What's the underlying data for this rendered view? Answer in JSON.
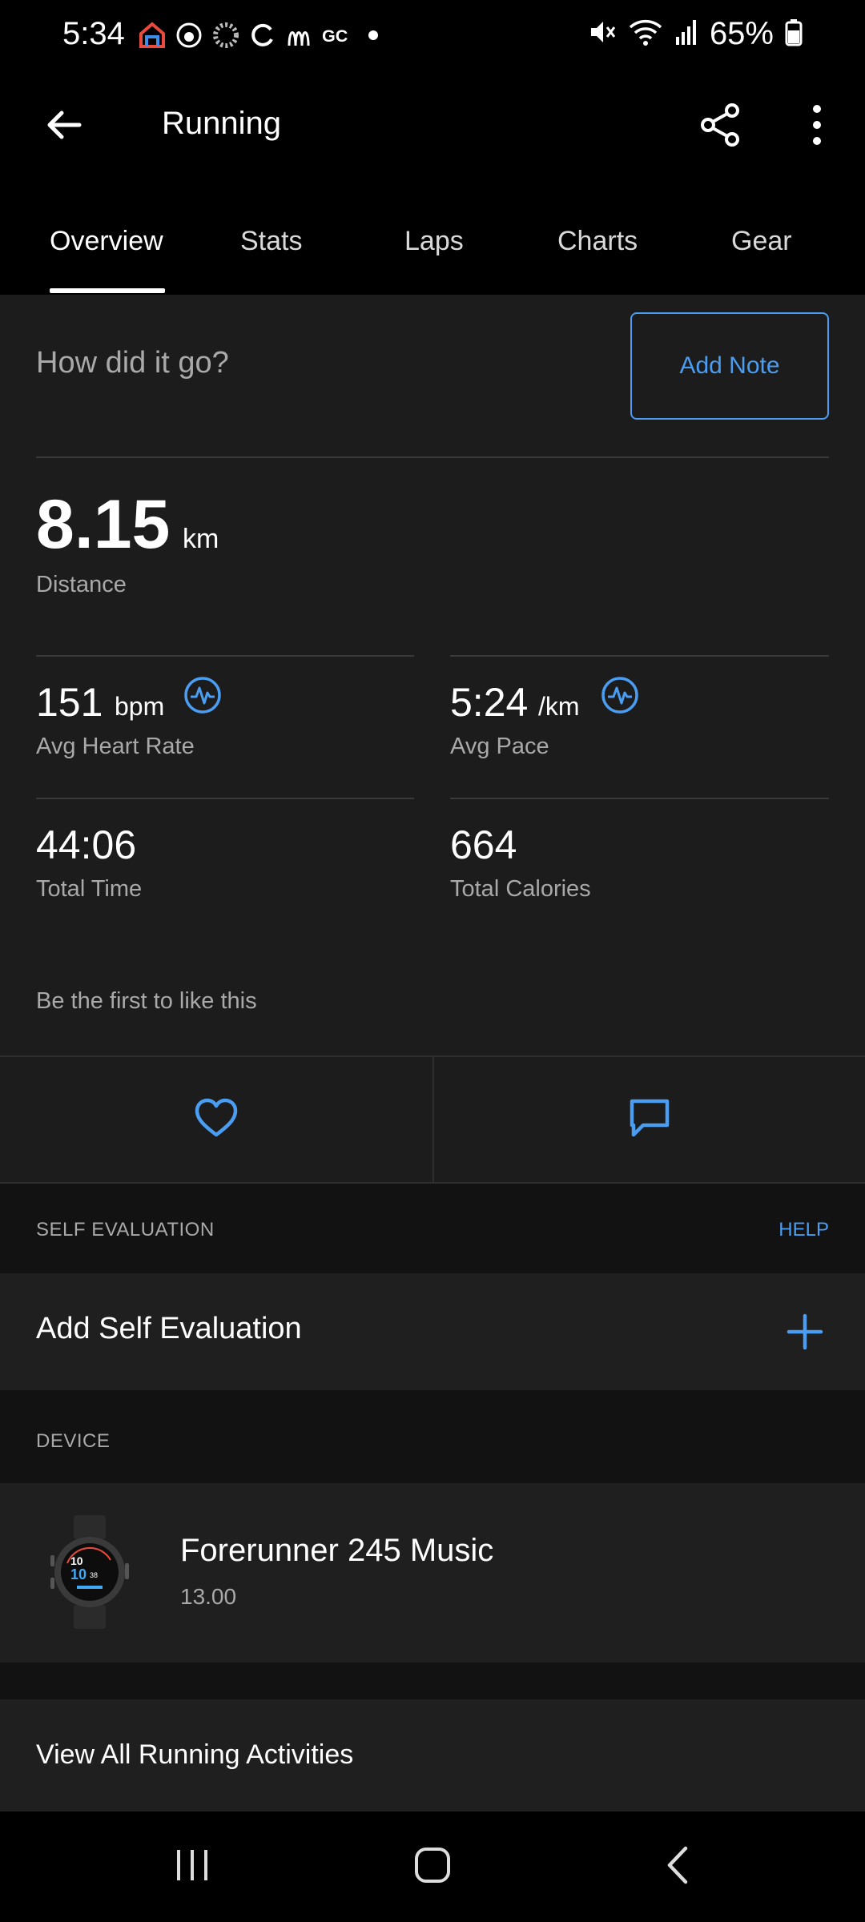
{
  "status_bar": {
    "time": "5:34",
    "battery": "65%",
    "left_icons": [
      "home-color-icon",
      "sun-icon",
      "spinner-icon",
      "refresh-icon",
      "m-logo-icon",
      "gc-logo-icon",
      "dot-icon"
    ],
    "right_icons": [
      "mute-icon",
      "wifi-icon",
      "signal-icon",
      "battery-icon"
    ]
  },
  "app_bar": {
    "title": "Running",
    "icons": [
      "back-arrow-icon",
      "share-icon",
      "more-vertical-icon"
    ]
  },
  "tabs": [
    {
      "label": "Overview",
      "active": true
    },
    {
      "label": "Stats",
      "active": false
    },
    {
      "label": "Laps",
      "active": false
    },
    {
      "label": "Charts",
      "active": false
    },
    {
      "label": "Gear",
      "active": false
    }
  ],
  "note": {
    "prompt": "How did it go?",
    "button": "Add Note"
  },
  "stats": {
    "distance": {
      "value": "8.15",
      "unit": "km",
      "label": "Distance"
    },
    "heart_rate": {
      "value": "151",
      "unit": "bpm",
      "label": "Avg Heart Rate"
    },
    "pace": {
      "value": "5:24",
      "unit": "/km",
      "label": "Avg Pace"
    },
    "time": {
      "value": "44:06",
      "label": "Total Time"
    },
    "calories": {
      "value": "664",
      "label": "Total Calories"
    }
  },
  "social": {
    "likes_text": "Be the first to like this",
    "icons": [
      "heart-icon",
      "comment-icon"
    ]
  },
  "self_evaluation": {
    "header": "SELF EVALUATION",
    "help": "HELP",
    "row_label": "Add Self Evaluation"
  },
  "device": {
    "header": "DEVICE",
    "name": "Forerunner 245 Music",
    "version": "13.00"
  },
  "view_all": {
    "label": "View All Running Activities"
  },
  "nav_bar": {
    "icons": [
      "recents-icon",
      "home-icon",
      "back-icon"
    ]
  },
  "colors": {
    "accent": "#4a9df0",
    "background": "#000000",
    "surface": "#1c1c1c",
    "secondary_text": "#a9a9a9"
  }
}
